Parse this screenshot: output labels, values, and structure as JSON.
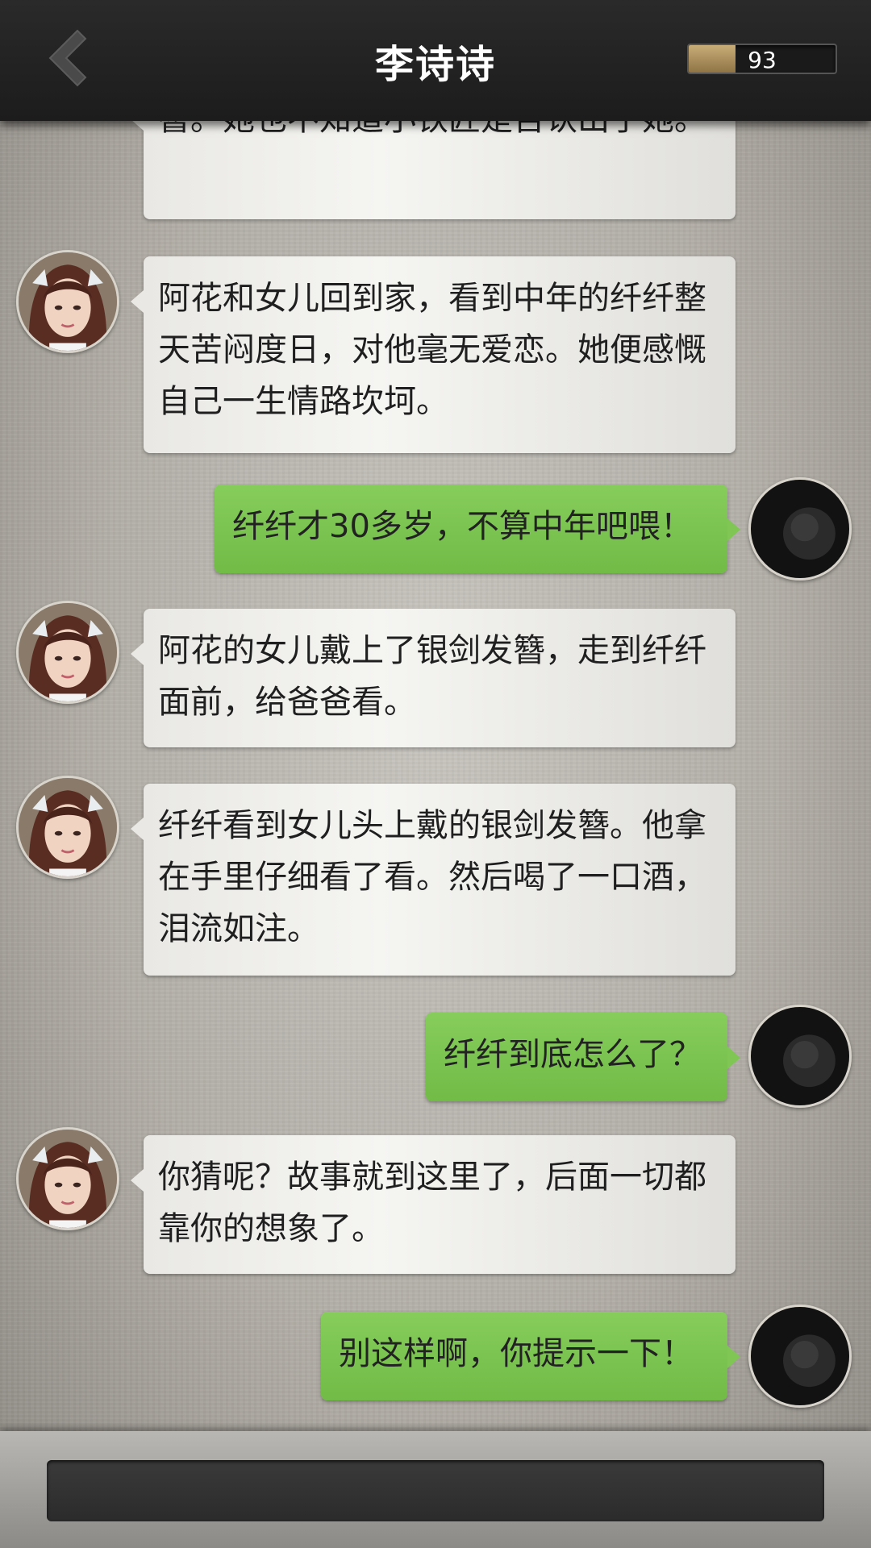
{
  "header": {
    "title": "李诗诗",
    "back_icon": "chevron-left-icon",
    "energy_value": "93",
    "energy_fraction": 0.32
  },
  "messages": [
    {
      "from": "her",
      "text": "簪。她也不知道小铁匠是否认出了她。"
    },
    {
      "from": "her",
      "text": "阿花和女儿回到家，看到中年的纤纤整天苦闷度日，对他毫无爱恋。她便感慨自己一生情路坎坷。"
    },
    {
      "from": "me",
      "text": "纤纤才30多岁，不算中年吧喂！"
    },
    {
      "from": "her",
      "text": "阿花的女儿戴上了银剑发簪，走到纤纤面前，给爸爸看。"
    },
    {
      "from": "her",
      "text": "纤纤看到女儿头上戴的银剑发簪。他拿在手里仔细看了看。然后喝了一口酒，泪流如注。"
    },
    {
      "from": "me",
      "text": "纤纤到底怎么了？"
    },
    {
      "from": "her",
      "text": "你猜呢？故事就到这里了，后面一切都靠你的想象了。"
    },
    {
      "from": "me",
      "text": "别这样啊，你提示一下！"
    }
  ],
  "colors": {
    "header_bg": "#222222",
    "incoming_bubble": "#efefec",
    "outgoing_bubble": "#7cc350",
    "energy_fill": "#b0925f"
  }
}
